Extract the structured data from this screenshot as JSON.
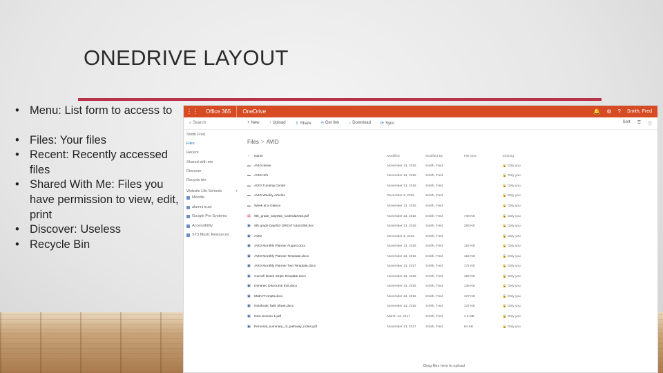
{
  "slide": {
    "title": "ONEDRIVE LAYOUT",
    "accent_color": "#b8334a",
    "bullets": [
      "Menu: List form to access to",
      "Files:  Your files",
      " Recent: Recently accessed files",
      "Shared With Me: Files you have permission to view, edit, print",
      "Discover: Useless",
      "Recycle Bin"
    ]
  },
  "onedrive": {
    "suite_color": "#d64b24",
    "waffle_icon": "app-launcher-icon",
    "suite_name": "Office 365",
    "app_name": "OneDrive",
    "user_name": "Smith, Fred",
    "search_placeholder": "Search",
    "commands": [
      {
        "icon": "plus-icon",
        "glyph": "+",
        "label": "New"
      },
      {
        "icon": "upload-icon",
        "glyph": "↑",
        "label": "Upload"
      },
      {
        "icon": "share-icon",
        "glyph": "⇪",
        "label": "Share"
      },
      {
        "icon": "link-icon",
        "glyph": "∞",
        "label": "Get link"
      },
      {
        "icon": "download-icon",
        "glyph": "↓",
        "label": "Download"
      },
      {
        "icon": "sync-icon",
        "glyph": "⟳",
        "label": "Sync"
      }
    ],
    "view_label": "Sort",
    "nav": [
      "Smith Fred",
      "Files",
      "Recent",
      "Shared with me",
      "Discover",
      "Recycle bin"
    ],
    "active_nav": "Files",
    "groups_label": "Website Life Schools",
    "groups": [
      "Moodle",
      "alumni trust",
      "Google Pro Systems",
      "Accessibility",
      "ST3 Music Resources"
    ],
    "breadcrumb": [
      "Files",
      "AVID"
    ],
    "columns": [
      "Name",
      "Modified",
      "Modified By",
      "File Size",
      "Sharing"
    ],
    "files": [
      {
        "type": "folder",
        "name": "AVID Ideas",
        "modified": "November 13, 2015",
        "by": "Smith, Fred",
        "size": "",
        "sharing": "Only you"
      },
      {
        "type": "folder",
        "name": "AVID Info",
        "modified": "November 13, 2015",
        "by": "Smith, Fred",
        "size": "",
        "sharing": "Only you"
      },
      {
        "type": "folder",
        "name": "AVID Tutoring Center",
        "modified": "November 13, 2015",
        "by": "Smith, Fred",
        "size": "",
        "sharing": "Only you"
      },
      {
        "type": "folder",
        "name": "AVID Weekly Articles",
        "modified": "December 3, 2015",
        "by": "Smith, Fred",
        "size": "",
        "sharing": "Only you"
      },
      {
        "type": "folder",
        "name": "Week at a Glance",
        "modified": "November 13, 2015",
        "by": "Smith, Fred",
        "size": "",
        "sharing": "Only you"
      },
      {
        "type": "pdf",
        "name": "9th_grade_Day002_Calendar003.pdf",
        "modified": "November 13, 2015",
        "by": "Smith, Fred",
        "size": "748 KB",
        "sharing": "Only you"
      },
      {
        "type": "doc",
        "name": "9th grade Day003 GREAT tutor1098.doc",
        "modified": "November 13, 2015",
        "by": "Smith, Fred",
        "size": "258 KB",
        "sharing": "Only you"
      },
      {
        "type": "doc",
        "name": "AVID",
        "modified": "December 3, 2015",
        "by": "Smith, Fred",
        "size": "",
        "sharing": "Only you"
      },
      {
        "type": "doc",
        "name": "AVID Monthly Planner August.docx",
        "modified": "November 13, 2015",
        "by": "Smith, Fred",
        "size": "152 KB",
        "sharing": "Only you"
      },
      {
        "type": "doc",
        "name": "AVID Monthly Planner Template.docx",
        "modified": "November 13, 2015",
        "by": "Smith, Fred",
        "size": "152 KB",
        "sharing": "Only you"
      },
      {
        "type": "doc",
        "name": "AVID Monthly Planner Two Template.docx",
        "modified": "November 13, 2017",
        "by": "Smith, Fred",
        "size": "171 KB",
        "sharing": "Only you"
      },
      {
        "type": "doc",
        "name": "Cornell Notes Strips Template.docx",
        "modified": "November 13, 2015",
        "by": "Smith, Fred",
        "size": "156 KB",
        "sharing": "Only you"
      },
      {
        "type": "doc",
        "name": "Dynamic Discourse Exit.docx",
        "modified": "November 13, 2015",
        "by": "Smith, Fred",
        "size": "136 KB",
        "sharing": "Only you"
      },
      {
        "type": "doc",
        "name": "Math Prompts.docx",
        "modified": "November 13, 2015",
        "by": "Smith, Fred",
        "size": "137 KB",
        "sharing": "Only you"
      },
      {
        "type": "doc",
        "name": "Notebook Task Sheet.docx",
        "modified": "November 13, 2015",
        "by": "Smith, Fred",
        "size": "137 KB",
        "sharing": "Only you"
      },
      {
        "type": "doc",
        "name": "New Section 1.pdf",
        "modified": "March 14, 2017",
        "by": "Smith, Fred",
        "size": "1.9 MB",
        "sharing": "Only you"
      },
      {
        "type": "doc",
        "name": "Personal_summary_of_pathway_notes.pdf",
        "modified": "November 13, 2017",
        "by": "Smith, Fred",
        "size": "84 KB",
        "sharing": "Only you"
      }
    ],
    "drag_hint": "Drag files here to upload"
  }
}
